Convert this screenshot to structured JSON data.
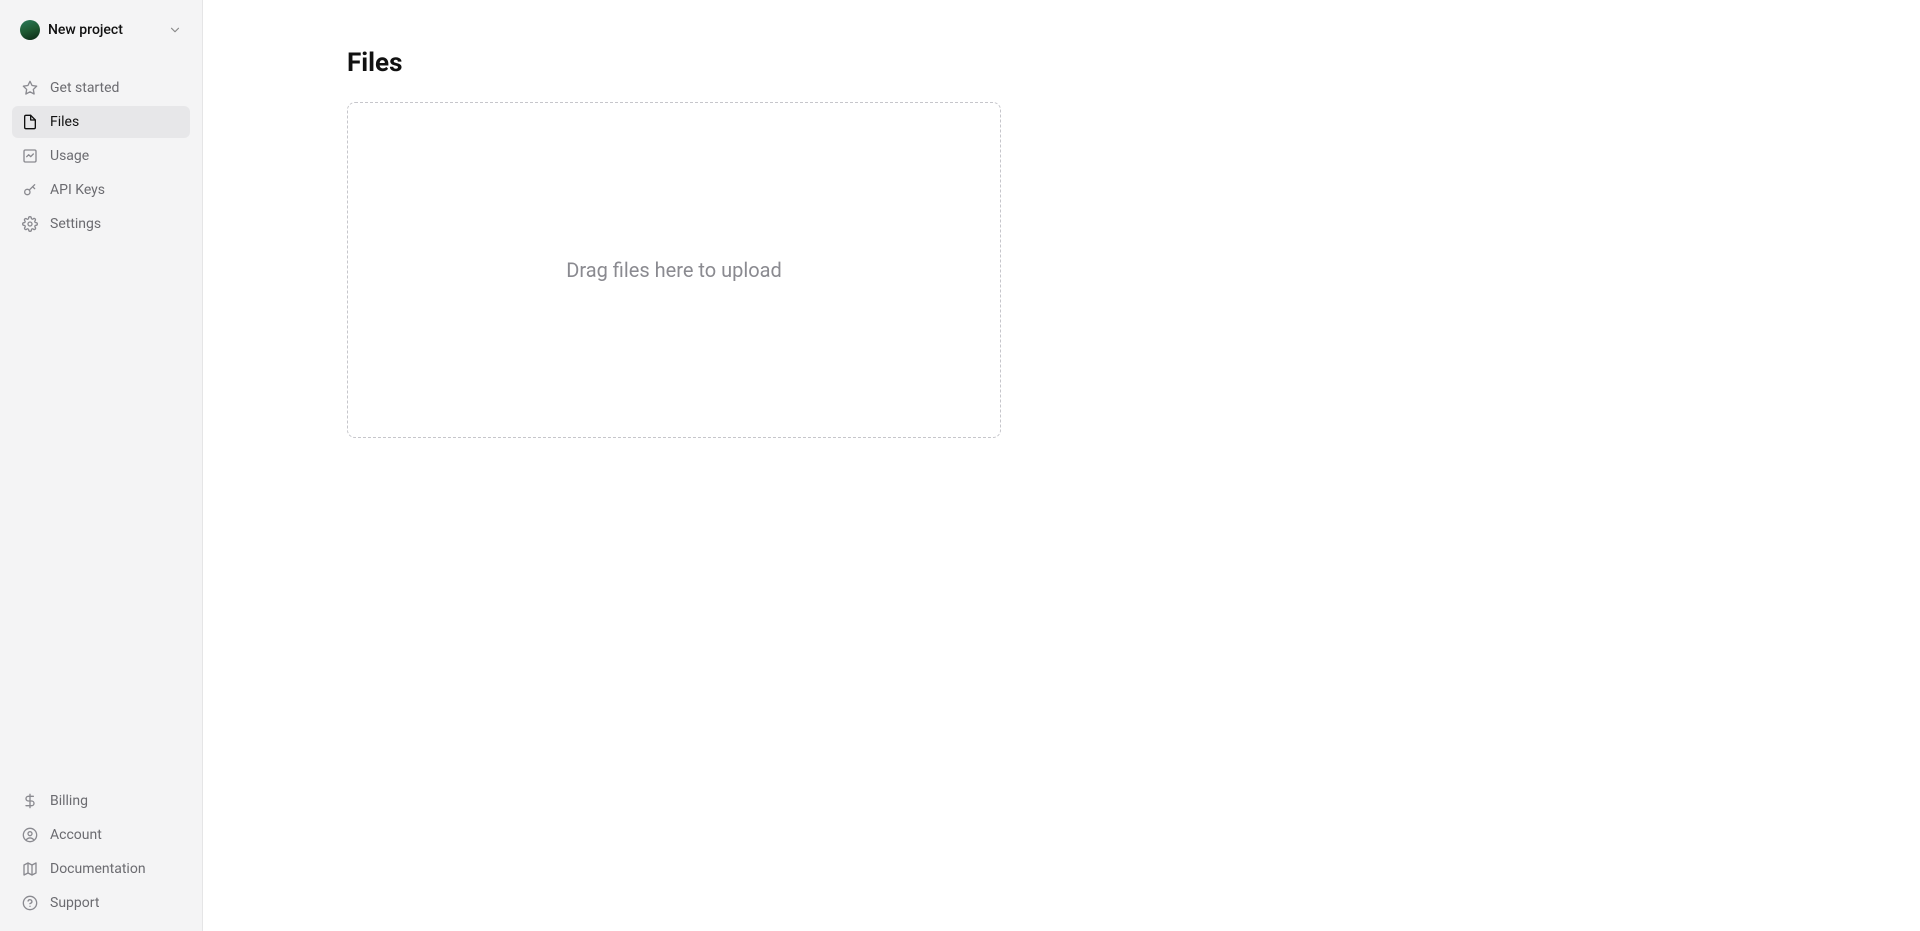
{
  "project": {
    "name": "New project"
  },
  "sidebar": {
    "items": [
      {
        "label": "Get started"
      },
      {
        "label": "Files"
      },
      {
        "label": "Usage"
      },
      {
        "label": "API Keys"
      },
      {
        "label": "Settings"
      }
    ],
    "footer": [
      {
        "label": "Billing"
      },
      {
        "label": "Account"
      },
      {
        "label": "Documentation"
      },
      {
        "label": "Support"
      }
    ]
  },
  "main": {
    "title": "Files",
    "dropzone_text": "Drag files here to upload"
  }
}
